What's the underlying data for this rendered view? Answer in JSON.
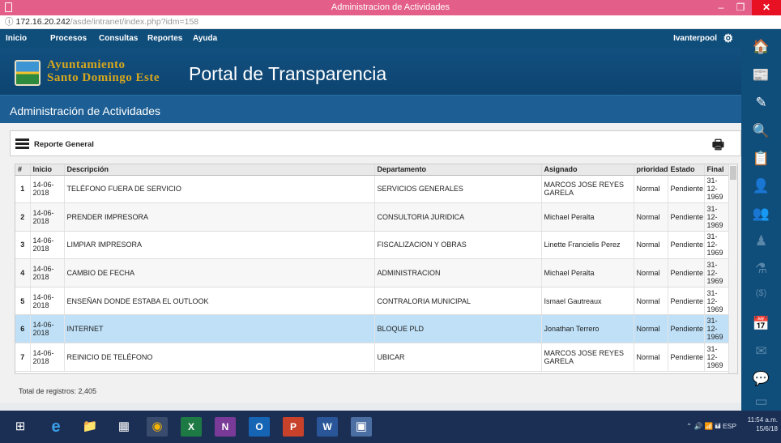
{
  "window": {
    "title": "Administracion de Actividades",
    "min": "–",
    "max": "❐",
    "close": "✕"
  },
  "url": {
    "info": "ⓘ",
    "host": "172.16.20.242",
    "path": "/asde/intranet/index.php?idm=158"
  },
  "menu": {
    "items": [
      "Inicio",
      "Procesos",
      "Consultas",
      "Reportes",
      "Ayuda"
    ],
    "user": "Ivanterpool",
    "gear_icon": "⚙"
  },
  "banner": {
    "org_line1": "Ayuntamiento",
    "org_line2": "Santo Domingo Este",
    "portal_title": "Portal de Transparencia"
  },
  "page": {
    "title": "Administración de Actividades"
  },
  "toolbox": {
    "label": "Reporte General",
    "print_icon": "🖶"
  },
  "table": {
    "headers": [
      "#",
      "Inicio",
      "Descripción",
      "Departamento",
      "Asignado",
      "prioridad",
      "Estado",
      "Final"
    ],
    "rows": [
      {
        "n": "1",
        "inicio": "14-06-2018",
        "desc": "TELÉFONO FUERA DE SERVICIO",
        "depto": "SERVICIOS GENERALES",
        "asignado": "MARCOS JOSE REYES GARELA",
        "prioridad": "Normal",
        "estado": "Pendiente",
        "final": "31-12-1969"
      },
      {
        "n": "2",
        "inicio": "14-06-2018",
        "desc": "PRENDER IMPRESORA",
        "depto": "CONSULTORIA JURIDICA",
        "asignado": "Michael Peralta",
        "prioridad": "Normal",
        "estado": "Pendiente",
        "final": "31-12-1969"
      },
      {
        "n": "3",
        "inicio": "14-06-2018",
        "desc": "LIMPIAR IMPRESORA",
        "depto": "FISCALIZACION Y OBRAS",
        "asignado": "Linette Francielis Perez",
        "prioridad": "Normal",
        "estado": "Pendiente",
        "final": "31-12-1969"
      },
      {
        "n": "4",
        "inicio": "14-06-2018",
        "desc": "CAMBIO DE FECHA",
        "depto": "ADMINISTRACION",
        "asignado": "Michael Peralta",
        "prioridad": "Normal",
        "estado": "Pendiente",
        "final": "31-12-1969"
      },
      {
        "n": "5",
        "inicio": "14-06-2018",
        "desc": "ENSEÑAN DONDE ESTABA EL OUTLOOK",
        "depto": "CONTRALORIA MUNICIPAL",
        "asignado": "Ismael Gautreaux",
        "prioridad": "Normal",
        "estado": "Pendiente",
        "final": "31-12-1969"
      },
      {
        "n": "6",
        "inicio": "14-06-2018",
        "desc": "INTERNET",
        "depto": "BLOQUE PLD",
        "asignado": "Jonathan Terrero",
        "prioridad": "Normal",
        "estado": "Pendiente",
        "final": "31-12-1969"
      },
      {
        "n": "7",
        "inicio": "14-06-2018",
        "desc": "REINICIO DE TELÉFONO",
        "depto": "UBICAR",
        "asignado": "MARCOS JOSE REYES GARELA",
        "prioridad": "Normal",
        "estado": "Pendiente",
        "final": "31-12-1969"
      }
    ]
  },
  "total": "Total de registros: 2,405",
  "charms": [
    "🏠",
    "📰",
    "✎",
    "🔍",
    "📋",
    "👤",
    "👥",
    "♟",
    "⚗",
    "($)",
    "📅",
    "✉",
    "💬",
    "▭"
  ],
  "taskbar": {
    "apps": [
      "⊞",
      "e",
      "📁",
      "▦",
      "◉",
      "X",
      "N",
      "O",
      "P",
      "W",
      "▣"
    ],
    "tray": "⌃ 🔊 📶 🖬 ESP",
    "time": "11:54 a.m.",
    "date": "15/6/18"
  },
  "colors": {
    "title_bar": "#e35f8a",
    "nav_blue": "#0f4d7a",
    "header_blue": "#1d5f94",
    "selected_row": "#bfe0f7",
    "taskbar": "#1b2f55"
  }
}
